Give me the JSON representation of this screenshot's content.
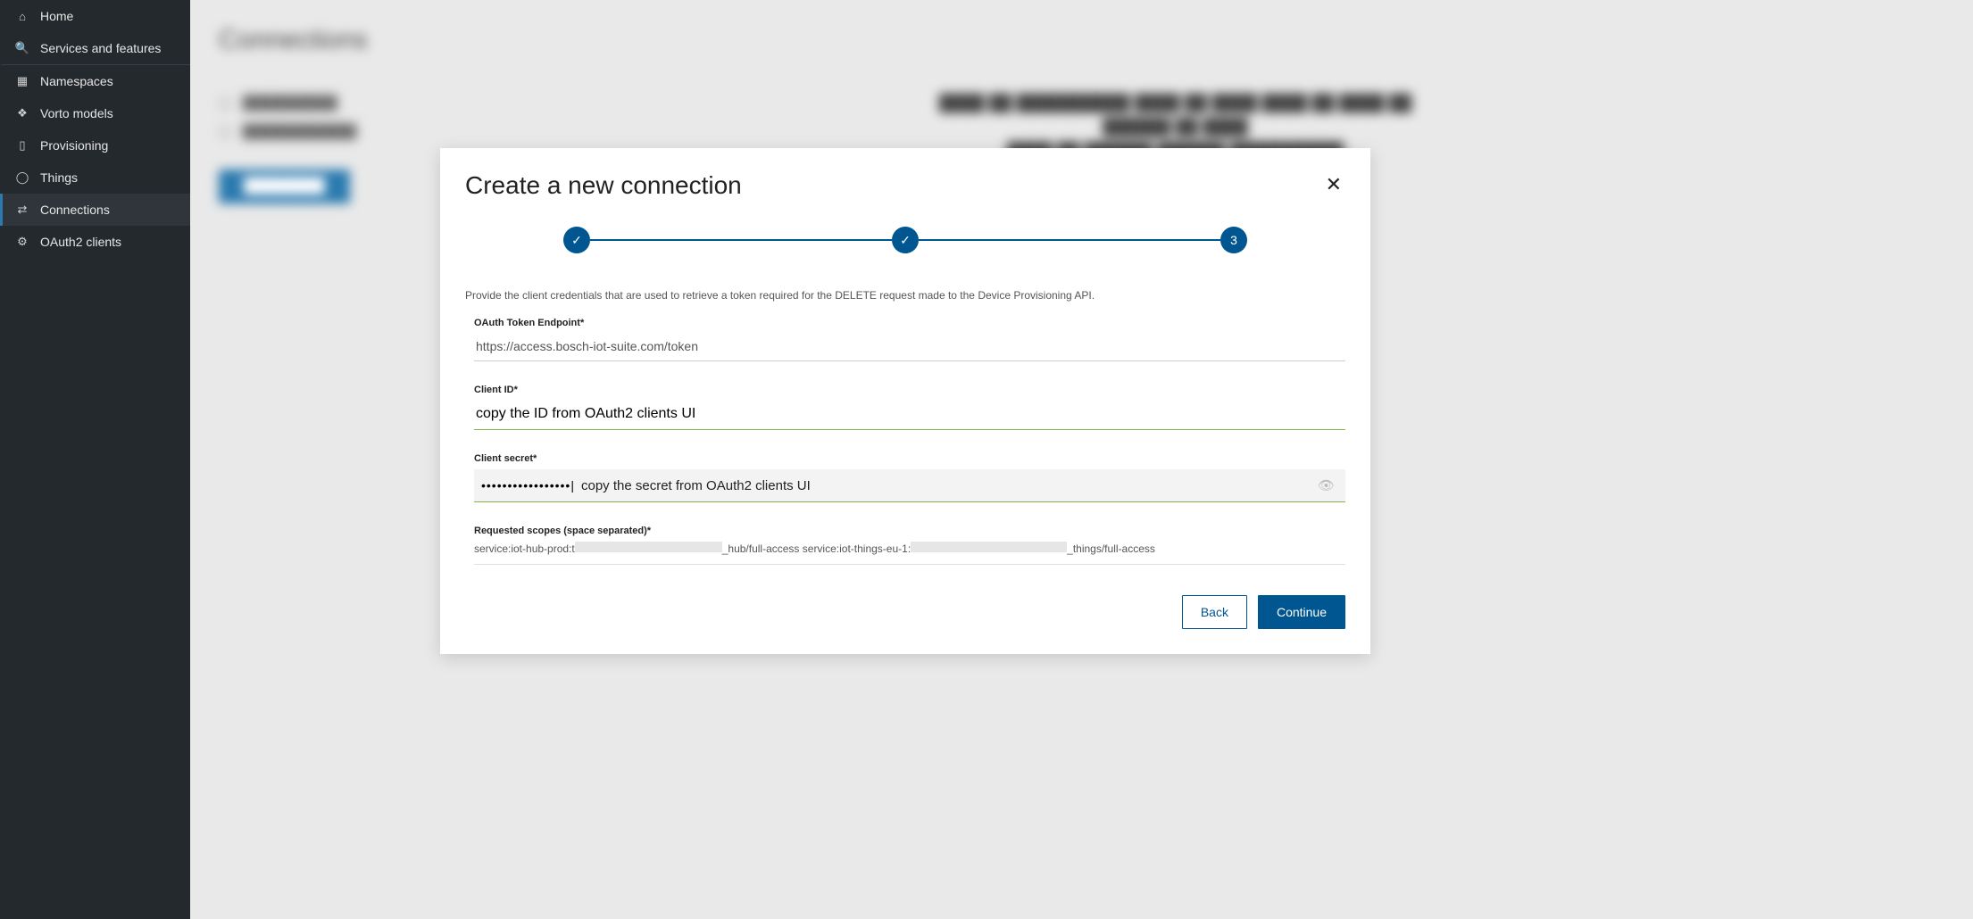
{
  "sidebar": {
    "items": [
      {
        "label": "Home",
        "icon": "⌂"
      },
      {
        "label": "Services and features",
        "icon": "🔍"
      },
      {
        "label": "Namespaces",
        "icon": "▦"
      },
      {
        "label": "Vorto models",
        "icon": "❖"
      },
      {
        "label": "Provisioning",
        "icon": "▯"
      },
      {
        "label": "Things",
        "icon": "◯"
      },
      {
        "label": "Connections",
        "icon": "⇄"
      },
      {
        "label": "OAuth2 clients",
        "icon": "⚙"
      }
    ]
  },
  "page": {
    "title": "Connections"
  },
  "modal": {
    "title": "Create a new connection",
    "stepper": {
      "steps": [
        "✓",
        "✓",
        "3"
      ],
      "current": 3
    },
    "description": "Provide the client credentials that are used to retrieve a token required for the DELETE request made to the Device Provisioning API.",
    "fields": {
      "oauth_endpoint": {
        "label": "OAuth Token Endpoint*",
        "value": "https://access.bosch-iot-suite.com/token"
      },
      "client_id": {
        "label": "Client ID*",
        "value": "copy the ID from OAuth2 clients UI"
      },
      "client_secret": {
        "label": "Client secret*",
        "masked_value": "•••••••••••••••••|",
        "hint": "copy the secret from OAuth2 clients UI"
      },
      "scopes": {
        "label": "Requested scopes (space separated)*",
        "prefix1": "service:iot-hub-prod:t",
        "mid1": "_hub/full-access service:iot-things-eu-1:",
        "suffix": "_things/full-access"
      }
    },
    "buttons": {
      "back": "Back",
      "continue": "Continue"
    }
  }
}
